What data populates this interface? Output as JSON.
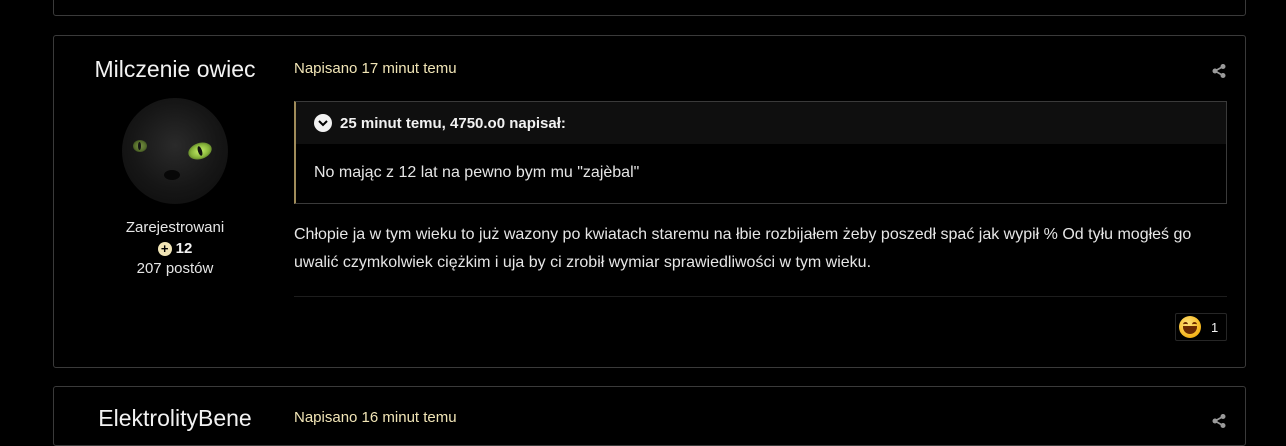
{
  "posts": [
    {
      "author": "Milczenie owiec",
      "group": "Zarejestrowani",
      "reputation": "12",
      "post_count": "207 postów",
      "posted": "Napisano 17 minut temu",
      "quote": {
        "header": "25 minut temu, 4750.o0 napisał:",
        "text": "No mając z 12 lat na pewno bym mu \"zajèbal\""
      },
      "body": "Chłopie ja w tym wieku to już wazony po kwiatach staremu na łbie rozbijałem żeby poszedł spać jak wypił % Od tyłu mogłeś go uwalić czymkolwiek ciężkim i uja by ci zrobił wymiar sprawiedliwości w tym wieku.",
      "reaction": {
        "icon": "laugh-emoji-icon",
        "count": "1"
      }
    },
    {
      "author": "ElektrolityBene",
      "posted": "Napisano 16 minut temu"
    }
  ],
  "colors": {
    "background": "#000000",
    "accent": "#f1e5b6",
    "border": "#3a3a3a"
  }
}
